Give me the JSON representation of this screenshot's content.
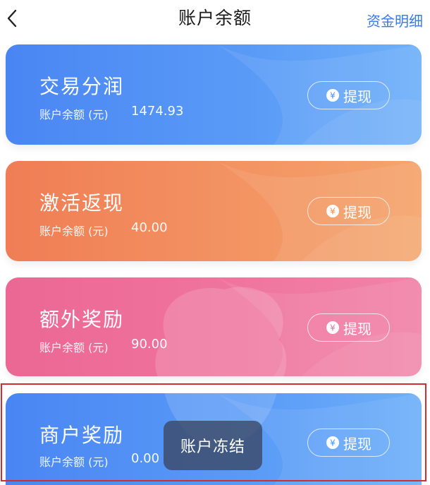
{
  "header": {
    "title": "账户余额",
    "detail_link": "资金明细"
  },
  "cards": [
    {
      "title": "交易分润",
      "balance_label": "账户余额 (元)",
      "balance_value": "1474.93",
      "withdraw_label": "提现",
      "color": "#4f8cf4"
    },
    {
      "title": "激活返现",
      "balance_label": "账户余额 (元)",
      "balance_value": "40.00",
      "withdraw_label": "提现",
      "color": "#f38b57"
    },
    {
      "title": "额外奖励",
      "balance_label": "账户余额 (元)",
      "balance_value": "90.00",
      "withdraw_label": "提现",
      "color": "#ee6f98"
    },
    {
      "title": "商户奖励",
      "balance_label": "账户余额 (元)",
      "balance_value": "0.00",
      "withdraw_label": "提现",
      "color": "#4f8cf4"
    }
  ],
  "toast": {
    "text": "账户冻结"
  },
  "icons": {
    "back": "chevron-left-icon",
    "yen": "yen-coin-icon"
  },
  "highlight_color": "#d12f2f"
}
